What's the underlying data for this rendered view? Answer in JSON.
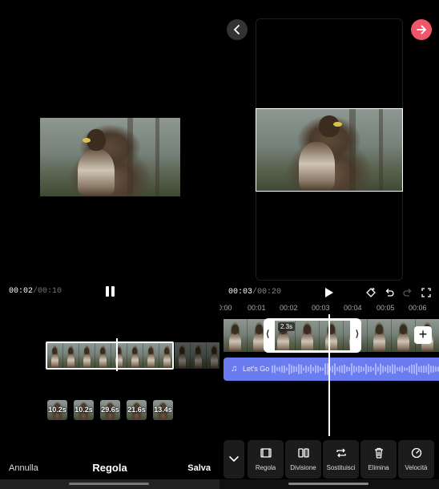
{
  "left_panel": {
    "time_current": "00:02",
    "time_separator": "/",
    "time_total": "00:10",
    "speed_presets": [
      "10.2s",
      "10.2s",
      "29.6s",
      "21.6s",
      "13.4s"
    ],
    "cancel_label": "Annulla",
    "title": "Regola",
    "save_label": "Salva"
  },
  "right_panel": {
    "time_current": "00:03",
    "time_separator": "/",
    "time_total": "00:20",
    "ruler_ticks": [
      "0:00",
      "00:01",
      "00:02",
      "00:03",
      "00:04",
      "00:05",
      "00:06"
    ],
    "clip_duration": "2.3s",
    "add_clip_label": "+",
    "clip_handle_left": "⟨",
    "clip_handle_right": "⟩",
    "audio_track_label": "Let's Go",
    "tools": [
      {
        "label": "Regola",
        "icon": "trim-icon"
      },
      {
        "label": "Divisione",
        "icon": "split-icon"
      },
      {
        "label": "Sostituisci",
        "icon": "replace-icon"
      },
      {
        "label": "Elimina",
        "icon": "trash-icon"
      },
      {
        "label": "Velocità",
        "icon": "speed-icon"
      }
    ]
  },
  "colors": {
    "accent_next": "#f0566a",
    "audio_track": "#6b7cf0",
    "background": "#000000"
  }
}
